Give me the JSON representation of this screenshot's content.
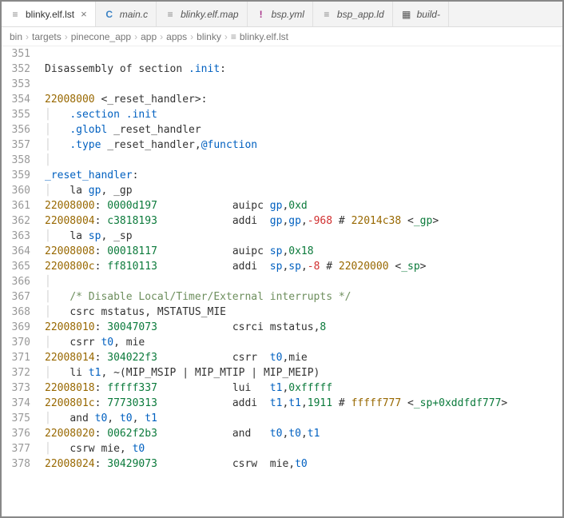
{
  "tabs": [
    {
      "label": "blinky.elf.lst",
      "icon": "≡",
      "iconClass": "file-icon",
      "active": true,
      "closable": true
    },
    {
      "label": "main.c",
      "icon": "C",
      "iconClass": "c-icon",
      "active": false,
      "closable": false
    },
    {
      "label": "blinky.elf.map",
      "icon": "≡",
      "iconClass": "file-icon",
      "active": false,
      "closable": false
    },
    {
      "label": "bsp.yml",
      "icon": "!",
      "iconClass": "yml-icon",
      "active": false,
      "closable": false
    },
    {
      "label": "bsp_app.ld",
      "icon": "≡",
      "iconClass": "file-icon",
      "active": false,
      "closable": false
    },
    {
      "label": "build-",
      "icon": "▦",
      "iconClass": "build-icon",
      "active": false,
      "closable": false
    }
  ],
  "breadcrumb": [
    "bin",
    "targets",
    "pinecone_app",
    "app",
    "apps",
    "blinky",
    "blinky.elf.lst"
  ],
  "breadcrumb_last_icon": "≡",
  "lines": [
    {
      "n": 351,
      "spans": []
    },
    {
      "n": 352,
      "spans": [
        {
          "t": "Disassembly of section ",
          "c": "tok-inst"
        },
        {
          "t": ".init",
          "c": "tok-kw"
        },
        {
          "t": ":",
          "c": "tok-punct"
        }
      ]
    },
    {
      "n": 353,
      "spans": []
    },
    {
      "n": 354,
      "spans": [
        {
          "t": "22008000",
          "c": "tok-addr"
        },
        {
          "t": " <",
          "c": "tok-punct"
        },
        {
          "t": "_reset_handler",
          "c": "tok-sym"
        },
        {
          "t": ">:",
          "c": "tok-punct"
        }
      ]
    },
    {
      "n": 355,
      "spans": [
        {
          "t": "│   ",
          "c": "folded-bar"
        },
        {
          "t": ".section",
          "c": "tok-kw"
        },
        {
          "t": " ",
          "c": ""
        },
        {
          "t": ".init",
          "c": "tok-kw"
        }
      ]
    },
    {
      "n": 356,
      "spans": [
        {
          "t": "│   ",
          "c": "folded-bar"
        },
        {
          "t": ".globl",
          "c": "tok-kw"
        },
        {
          "t": " _reset_handler",
          "c": "tok-sym"
        }
      ]
    },
    {
      "n": 357,
      "spans": [
        {
          "t": "│   ",
          "c": "folded-bar"
        },
        {
          "t": ".type",
          "c": "tok-kw"
        },
        {
          "t": " _reset_handler,",
          "c": "tok-sym"
        },
        {
          "t": "@function",
          "c": "tok-kw"
        }
      ]
    },
    {
      "n": 358,
      "spans": [
        {
          "t": "│",
          "c": "folded-bar"
        }
      ]
    },
    {
      "n": 359,
      "spans": [
        {
          "t": "_reset_handler",
          "c": "tok-kw"
        },
        {
          "t": ":",
          "c": "tok-punct"
        }
      ]
    },
    {
      "n": 360,
      "spans": [
        {
          "t": "│   ",
          "c": "folded-bar"
        },
        {
          "t": "la ",
          "c": "tok-inst"
        },
        {
          "t": "gp",
          "c": "tok-kw"
        },
        {
          "t": ", _gp",
          "c": "tok-sym"
        }
      ]
    },
    {
      "n": 361,
      "spans": [
        {
          "t": "22008000",
          "c": "tok-addr"
        },
        {
          "t": ": ",
          "c": "tok-punct"
        },
        {
          "t": "0000d197",
          "c": "tok-hex"
        },
        {
          "t": "            auipc ",
          "c": "tok-inst"
        },
        {
          "t": "gp",
          "c": "tok-kw"
        },
        {
          "t": ",",
          "c": "tok-punct"
        },
        {
          "t": "0xd",
          "c": "tok-hex"
        }
      ]
    },
    {
      "n": 362,
      "spans": [
        {
          "t": "22008004",
          "c": "tok-addr"
        },
        {
          "t": ": ",
          "c": "tok-punct"
        },
        {
          "t": "c3818193",
          "c": "tok-hex"
        },
        {
          "t": "            addi  ",
          "c": "tok-inst"
        },
        {
          "t": "gp",
          "c": "tok-kw"
        },
        {
          "t": ",",
          "c": "tok-punct"
        },
        {
          "t": "gp",
          "c": "tok-kw"
        },
        {
          "t": ",",
          "c": "tok-punct"
        },
        {
          "t": "-968",
          "c": "tok-neg"
        },
        {
          "t": " # ",
          "c": "tok-punct"
        },
        {
          "t": "22014c38",
          "c": "tok-addr"
        },
        {
          "t": " <",
          "c": "tok-punct"
        },
        {
          "t": "_gp",
          "c": "tok-ref"
        },
        {
          "t": ">",
          "c": "tok-punct"
        }
      ]
    },
    {
      "n": 363,
      "spans": [
        {
          "t": "│   ",
          "c": "folded-bar"
        },
        {
          "t": "la ",
          "c": "tok-inst"
        },
        {
          "t": "sp",
          "c": "tok-kw"
        },
        {
          "t": ", _sp",
          "c": "tok-sym"
        }
      ]
    },
    {
      "n": 364,
      "spans": [
        {
          "t": "22008008",
          "c": "tok-addr"
        },
        {
          "t": ": ",
          "c": "tok-punct"
        },
        {
          "t": "00018117",
          "c": "tok-hex"
        },
        {
          "t": "            auipc ",
          "c": "tok-inst"
        },
        {
          "t": "sp",
          "c": "tok-kw"
        },
        {
          "t": ",",
          "c": "tok-punct"
        },
        {
          "t": "0x18",
          "c": "tok-hex"
        }
      ]
    },
    {
      "n": 365,
      "spans": [
        {
          "t": "2200800c",
          "c": "tok-addr"
        },
        {
          "t": ": ",
          "c": "tok-punct"
        },
        {
          "t": "ff810113",
          "c": "tok-hex"
        },
        {
          "t": "            addi  ",
          "c": "tok-inst"
        },
        {
          "t": "sp",
          "c": "tok-kw"
        },
        {
          "t": ",",
          "c": "tok-punct"
        },
        {
          "t": "sp",
          "c": "tok-kw"
        },
        {
          "t": ",",
          "c": "tok-punct"
        },
        {
          "t": "-8",
          "c": "tok-neg"
        },
        {
          "t": " # ",
          "c": "tok-punct"
        },
        {
          "t": "22020000",
          "c": "tok-addr"
        },
        {
          "t": " <",
          "c": "tok-punct"
        },
        {
          "t": "_sp",
          "c": "tok-ref"
        },
        {
          "t": ">",
          "c": "tok-punct"
        }
      ]
    },
    {
      "n": 366,
      "spans": [
        {
          "t": "│",
          "c": "folded-bar"
        }
      ]
    },
    {
      "n": 367,
      "spans": [
        {
          "t": "│   ",
          "c": "folded-bar"
        },
        {
          "t": "/* Disable Local/Timer/External interrupts */",
          "c": "tok-cmt"
        }
      ]
    },
    {
      "n": 368,
      "spans": [
        {
          "t": "│   ",
          "c": "folded-bar"
        },
        {
          "t": "csrc mstatus, MSTATUS_MIE",
          "c": "tok-inst"
        }
      ]
    },
    {
      "n": 369,
      "spans": [
        {
          "t": "22008010",
          "c": "tok-addr"
        },
        {
          "t": ": ",
          "c": "tok-punct"
        },
        {
          "t": "30047073",
          "c": "tok-hex"
        },
        {
          "t": "            csrci mstatus,",
          "c": "tok-inst"
        },
        {
          "t": "8",
          "c": "tok-num"
        }
      ]
    },
    {
      "n": 370,
      "spans": [
        {
          "t": "│   ",
          "c": "folded-bar"
        },
        {
          "t": "csrr ",
          "c": "tok-inst"
        },
        {
          "t": "t0",
          "c": "tok-kw"
        },
        {
          "t": ", mie",
          "c": "tok-inst"
        }
      ]
    },
    {
      "n": 371,
      "spans": [
        {
          "t": "22008014",
          "c": "tok-addr"
        },
        {
          "t": ": ",
          "c": "tok-punct"
        },
        {
          "t": "304022f3",
          "c": "tok-hex"
        },
        {
          "t": "            csrr  ",
          "c": "tok-inst"
        },
        {
          "t": "t0",
          "c": "tok-kw"
        },
        {
          "t": ",mie",
          "c": "tok-inst"
        }
      ]
    },
    {
      "n": 372,
      "spans": [
        {
          "t": "│   ",
          "c": "folded-bar"
        },
        {
          "t": "li ",
          "c": "tok-inst"
        },
        {
          "t": "t1",
          "c": "tok-kw"
        },
        {
          "t": ", ~(MIP_MSIP | MIP_MTIP | MIP_MEIP)",
          "c": "tok-inst"
        }
      ]
    },
    {
      "n": 373,
      "spans": [
        {
          "t": "22008018",
          "c": "tok-addr"
        },
        {
          "t": ": ",
          "c": "tok-punct"
        },
        {
          "t": "fffff337",
          "c": "tok-hex"
        },
        {
          "t": "            lui   ",
          "c": "tok-inst"
        },
        {
          "t": "t1",
          "c": "tok-kw"
        },
        {
          "t": ",",
          "c": "tok-punct"
        },
        {
          "t": "0xfffff",
          "c": "tok-hex"
        }
      ]
    },
    {
      "n": 374,
      "spans": [
        {
          "t": "2200801c",
          "c": "tok-addr"
        },
        {
          "t": ": ",
          "c": "tok-punct"
        },
        {
          "t": "77730313",
          "c": "tok-hex"
        },
        {
          "t": "            addi  ",
          "c": "tok-inst"
        },
        {
          "t": "t1",
          "c": "tok-kw"
        },
        {
          "t": ",",
          "c": "tok-punct"
        },
        {
          "t": "t1",
          "c": "tok-kw"
        },
        {
          "t": ",",
          "c": "tok-punct"
        },
        {
          "t": "1911",
          "c": "tok-num"
        },
        {
          "t": " # ",
          "c": "tok-punct"
        },
        {
          "t": "fffff777",
          "c": "tok-addr"
        },
        {
          "t": " <",
          "c": "tok-punct"
        },
        {
          "t": "_sp+0xddfdf777",
          "c": "tok-ref"
        },
        {
          "t": ">",
          "c": "tok-punct"
        }
      ]
    },
    {
      "n": 375,
      "spans": [
        {
          "t": "│   ",
          "c": "folded-bar"
        },
        {
          "t": "and ",
          "c": "tok-inst"
        },
        {
          "t": "t0",
          "c": "tok-kw"
        },
        {
          "t": ", ",
          "c": "tok-punct"
        },
        {
          "t": "t0",
          "c": "tok-kw"
        },
        {
          "t": ", ",
          "c": "tok-punct"
        },
        {
          "t": "t1",
          "c": "tok-kw"
        }
      ]
    },
    {
      "n": 376,
      "spans": [
        {
          "t": "22008020",
          "c": "tok-addr"
        },
        {
          "t": ": ",
          "c": "tok-punct"
        },
        {
          "t": "0062f2b3",
          "c": "tok-hex"
        },
        {
          "t": "            and   ",
          "c": "tok-inst"
        },
        {
          "t": "t0",
          "c": "tok-kw"
        },
        {
          "t": ",",
          "c": "tok-punct"
        },
        {
          "t": "t0",
          "c": "tok-kw"
        },
        {
          "t": ",",
          "c": "tok-punct"
        },
        {
          "t": "t1",
          "c": "tok-kw"
        }
      ]
    },
    {
      "n": 377,
      "spans": [
        {
          "t": "│   ",
          "c": "folded-bar"
        },
        {
          "t": "csrw mie, ",
          "c": "tok-inst"
        },
        {
          "t": "t0",
          "c": "tok-kw"
        }
      ]
    },
    {
      "n": 378,
      "spans": [
        {
          "t": "22008024",
          "c": "tok-addr"
        },
        {
          "t": ": ",
          "c": "tok-punct"
        },
        {
          "t": "30429073",
          "c": "tok-hex"
        },
        {
          "t": "            csrw  mie,",
          "c": "tok-inst"
        },
        {
          "t": "t0",
          "c": "tok-kw"
        }
      ]
    }
  ]
}
